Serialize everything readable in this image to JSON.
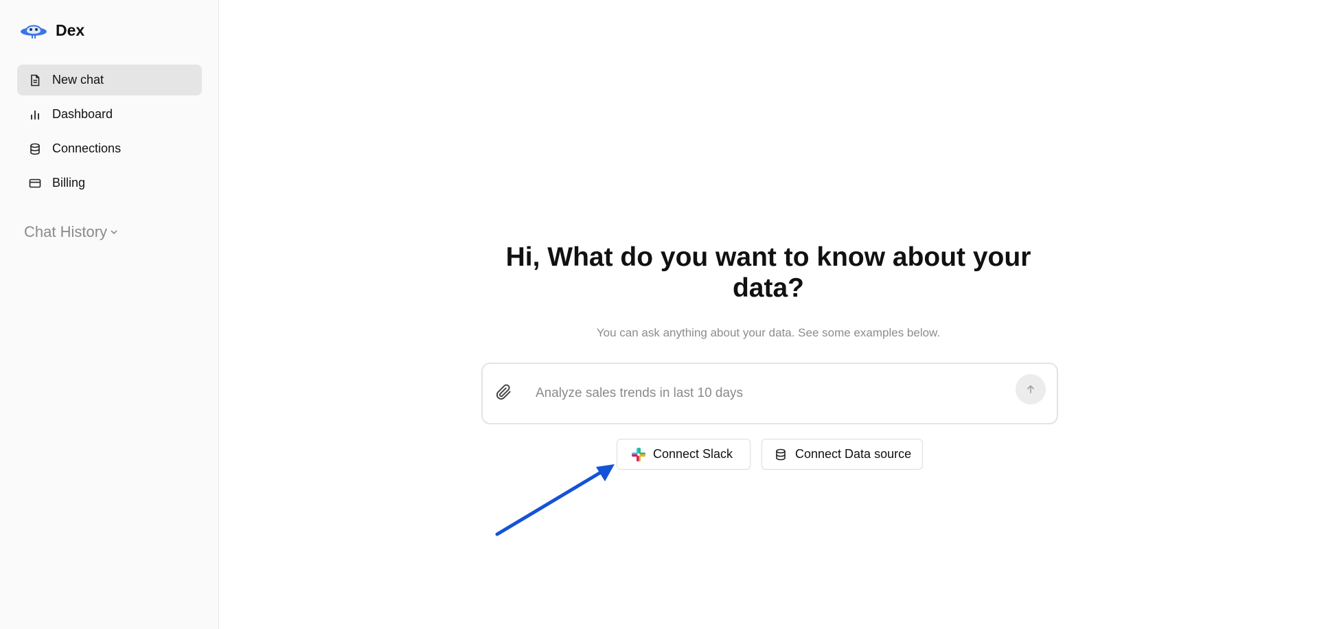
{
  "app": {
    "name": "Dex"
  },
  "sidebar": {
    "items": [
      {
        "label": "New chat",
        "icon": "document-icon",
        "active": true
      },
      {
        "label": "Dashboard",
        "icon": "bar-chart-icon",
        "active": false
      },
      {
        "label": "Connections",
        "icon": "database-icon",
        "active": false
      },
      {
        "label": "Billing",
        "icon": "credit-card-icon",
        "active": false
      }
    ],
    "history_label": "Chat History"
  },
  "main": {
    "title_line1": "Hi, What do you want to know about your",
    "title_line2": "data?",
    "subtitle": "You can ask anything about your data. See some examples below.",
    "input_placeholder": "Analyze sales trends in last 10 days",
    "buttons": {
      "slack": "Connect Slack",
      "datasource": "Connect Data source"
    }
  },
  "colors": {
    "accent_arrow": "#1553d6",
    "active_nav_bg": "#e5e5e5",
    "sidebar_bg": "#fafafa"
  }
}
